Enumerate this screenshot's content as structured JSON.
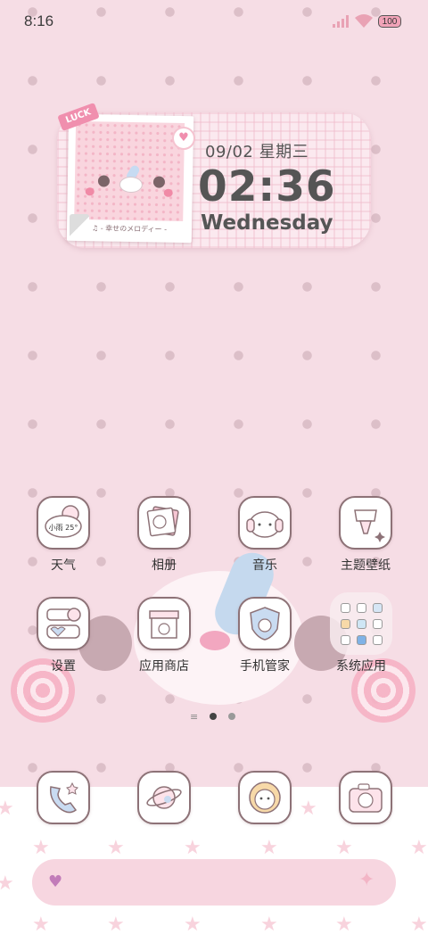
{
  "status_bar": {
    "time": "8:16",
    "battery": "100"
  },
  "widget": {
    "badge": "LUCK",
    "caption": "♫ - 幸せのメロディー -",
    "date": "09/02  星期三",
    "time": "02:36",
    "weekday": "Wednesday"
  },
  "apps": [
    {
      "label": "天气",
      "icon": "weather-icon",
      "icon_text": "小雨 25°"
    },
    {
      "label": "相册",
      "icon": "album-icon"
    },
    {
      "label": "音乐",
      "icon": "music-icon"
    },
    {
      "label": "主题壁纸",
      "icon": "theme-icon"
    },
    {
      "label": "设置",
      "icon": "settings-icon"
    },
    {
      "label": "应用商店",
      "icon": "app-store-icon"
    },
    {
      "label": "手机管家",
      "icon": "phone-manager-icon"
    },
    {
      "label": "系统应用",
      "icon": "folder-icon"
    }
  ],
  "page_indicator": {
    "pages": 2,
    "current": 1
  },
  "dock": [
    {
      "name": "phone",
      "icon": "phone-icon"
    },
    {
      "name": "browser",
      "icon": "browser-icon"
    },
    {
      "name": "messages",
      "icon": "messages-icon"
    },
    {
      "name": "camera",
      "icon": "camera-icon"
    }
  ],
  "colors": {
    "accent": "#f08fae",
    "background": "#f6dde5",
    "icon_border": "#8d7277",
    "text": "#333333"
  }
}
